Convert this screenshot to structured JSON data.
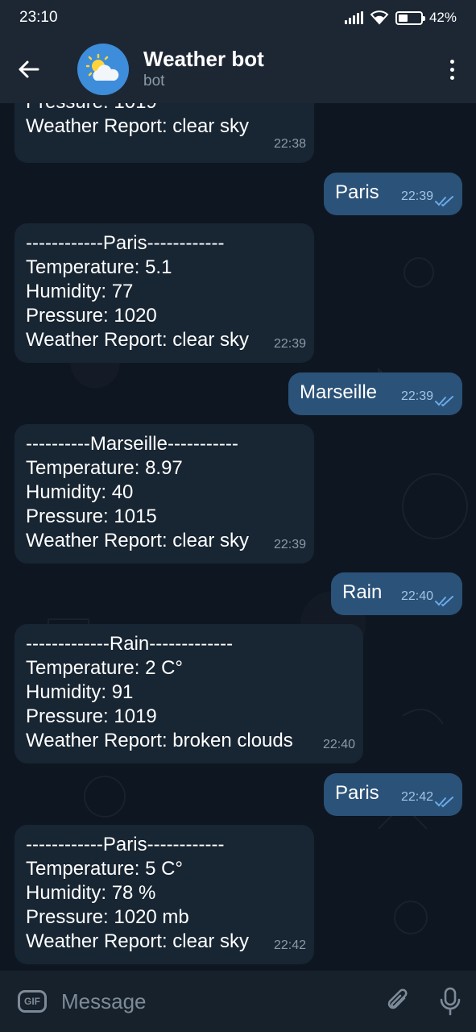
{
  "status_bar": {
    "time": "23:10",
    "battery_percent": "42%",
    "battery_level": 0.42
  },
  "header": {
    "title": "Weather bot",
    "subtitle": "bot"
  },
  "messages": [
    {
      "side": "in",
      "text": "Pressure: 1019\nWeather Report: clear sky",
      "time": "22:38"
    },
    {
      "side": "out",
      "text": "Paris",
      "time": "22:39"
    },
    {
      "side": "in",
      "text": "------------Paris------------\nTemperature: 5.1\nHumidity: 77\nPressure: 1020\nWeather Report: clear sky",
      "time": "22:39"
    },
    {
      "side": "out",
      "text": "Marseille",
      "time": "22:39"
    },
    {
      "side": "in",
      "text": "----------Marseille-----------\nTemperature: 8.97\nHumidity: 40\nPressure: 1015\nWeather Report: clear sky",
      "time": "22:39"
    },
    {
      "side": "out",
      "text": "Rain",
      "time": "22:40"
    },
    {
      "side": "in",
      "text": "-------------Rain-------------\nTemperature: 2 C°\nHumidity: 91\nPressure: 1019\nWeather Report: broken clouds",
      "time": "22:40"
    },
    {
      "side": "out",
      "text": "Paris",
      "time": "22:42"
    },
    {
      "side": "in",
      "text": "------------Paris------------\nTemperature: 5 C°\nHumidity: 78 %\nPressure: 1020 mb\nWeather Report: clear sky",
      "time": "22:42"
    }
  ],
  "input": {
    "gif_label": "GIF",
    "placeholder": "Message"
  },
  "colors": {
    "header_bg": "#1d2733",
    "chat_bg": "#0e1621",
    "incoming_bubble": "#182533",
    "outgoing_bubble": "#2b5278",
    "input_bg": "#17212b"
  },
  "icons": [
    "back-arrow-icon",
    "weather-sun-cloud-icon",
    "more-vert-icon",
    "gif-icon",
    "attach-icon",
    "mic-icon",
    "double-check-icon"
  ]
}
